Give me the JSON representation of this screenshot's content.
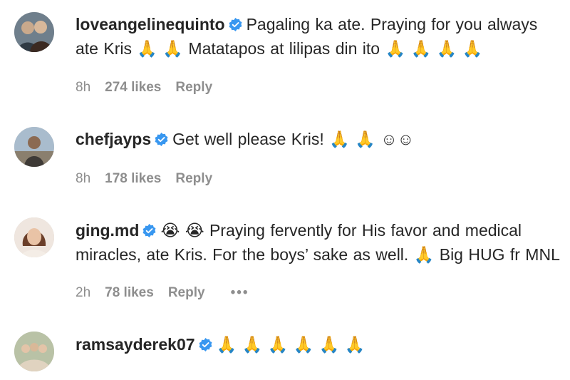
{
  "comments": [
    {
      "username": "loveangelinequinto",
      "text_line1": "Pagaling ka ate. Praying for you always",
      "text_line2": "ate Kris 🙏 🙏  Matatapos at lilipas din ito 🙏 🙏 🙏 🙏",
      "time": "8h",
      "likes": "274 likes",
      "reply": "Reply",
      "avatar_colors": [
        "#2f3a44",
        "#c9a98c"
      ]
    },
    {
      "username": "chefjayps",
      "text_line1": "Get well please Kris! 🙏 🙏 ☺☺",
      "time": "8h",
      "likes": "178 likes",
      "reply": "Reply",
      "avatar_colors": [
        "#9fb4c7",
        "#5a4636"
      ]
    },
    {
      "username": "ging.md",
      "text_line1": "😭 😭  Praying fervently for His favor and medical",
      "text_line2": "miracles, ate Kris. For the boys’ sake as well. 🙏  Big HUG fr MNL",
      "time": "2h",
      "likes": "78 likes",
      "reply": "Reply",
      "more": "•••",
      "avatar_colors": [
        "#e8d9cf",
        "#6b3f2a"
      ]
    },
    {
      "username": "ramsayderek07",
      "text_line1": "🙏 🙏 🙏 🙏 🙏 🙏",
      "avatar_colors": [
        "#b9c2a6",
        "#e0d3c0"
      ]
    }
  ],
  "colors": {
    "text": "#262626",
    "muted": "#8e8e8e",
    "verified": "#3897f0"
  }
}
